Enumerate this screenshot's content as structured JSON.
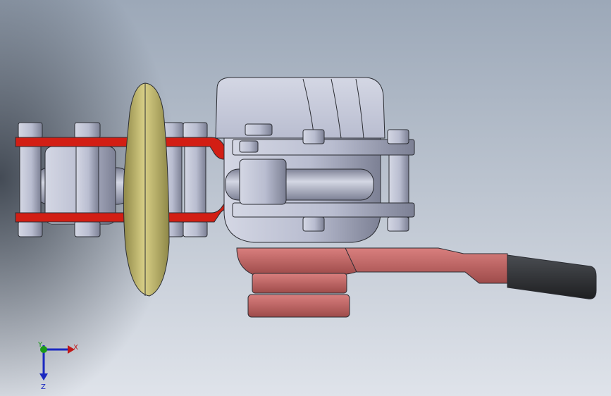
{
  "viewport": {
    "background_top": "#9ca8b8",
    "background_bottom": "#dfe3ea",
    "shadow_color": "#2f3640"
  },
  "colors": {
    "housing": "#b9bdd0",
    "housing_dark": "#7c8094",
    "housing_light": "#d4d7e4",
    "bolt": "#b3b7c8",
    "red_band": "#d21e14",
    "red_band_dark": "#8e1008",
    "wheel": "#d8cf86",
    "wheel_dark": "#8f8848",
    "pink_part": "#d97f7e",
    "pink_dark": "#9e4b4a",
    "grip": "#1e1f21",
    "grip_light": "#4a4d52",
    "edge": "#2b2d33"
  },
  "triad": {
    "x_label": "X",
    "y_label": "Y",
    "z_label": "Z",
    "x_color": "#c01818",
    "y_color": "#1a9a1a",
    "z_color": "#1a28c0"
  }
}
